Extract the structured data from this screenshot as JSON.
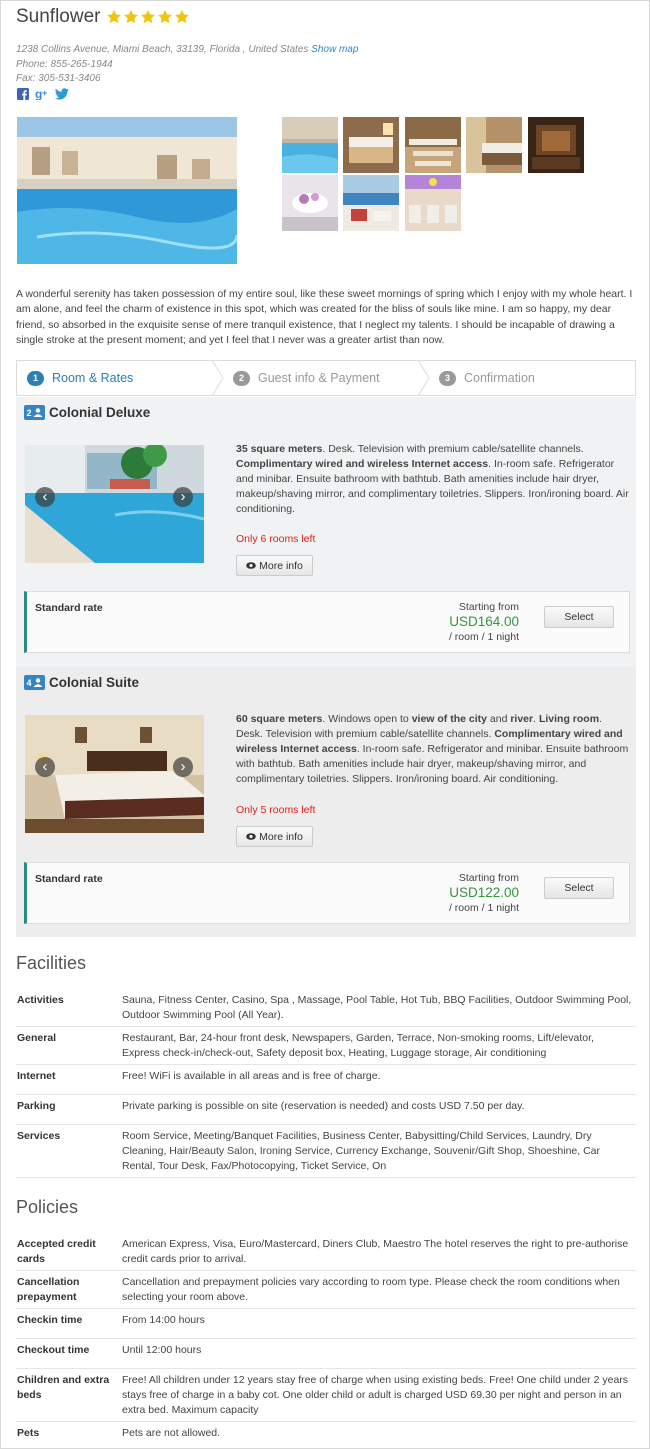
{
  "hotel": {
    "name": "Sunflower",
    "rating_stars": 5,
    "address": "1238 Collins Avenue, Miami Beach, 33139, Florida , United States",
    "show_map": "Show map",
    "phone": "Phone: 855-265-1944",
    "fax": "Fax: 305-531-3406",
    "description": "A wonderful serenity has taken possession of my entire soul, like these sweet mornings of spring which I enjoy with my whole heart. I am alone, and feel the charm of existence in this spot, which was created for the bliss of souls like mine. I am so happy, my dear friend, so absorbed in the exquisite sense of mere tranquil existence, that I neglect my talents. I should be incapable of drawing a single stroke at the present moment; and yet I feel that I never was a greater artist than now."
  },
  "social": [
    "facebook-icon",
    "google-plus-icon",
    "twitter-icon"
  ],
  "steps": [
    {
      "num": "1",
      "label": "Room & Rates",
      "active": true
    },
    {
      "num": "2",
      "label": "Guest info & Payment",
      "active": false
    },
    {
      "num": "3",
      "label": "Confirmation",
      "active": false
    }
  ],
  "rooms": [
    {
      "capacity": "2",
      "name": "Colonial Deluxe",
      "rooms_left": "Only 6 rooms left",
      "more_info": "More info",
      "rate_name": "Standard rate",
      "starting_from": "Starting from",
      "price": "USD164.00",
      "per": "/ room / 1 night",
      "select": "Select"
    },
    {
      "capacity": "4",
      "name": "Colonial Suite",
      "rooms_left": "Only 5 rooms left",
      "more_info": "More info",
      "rate_name": "Standard rate",
      "starting_from": "Starting from",
      "price": "USD122.00",
      "per": "/ room / 1 night",
      "select": "Select"
    }
  ],
  "room_text": {
    "r1_b1": "35 square meters",
    "r1_t1": ". Desk. Television with premium cable/satellite channels. ",
    "r1_b2": "Complimentary wired and wireless Internet access",
    "r1_t2": ". In-room safe. Refrigerator and minibar. Ensuite bathroom with bathtub. Bath amenities include hair dryer, makeup/shaving mirror, and complimentary toiletries. Slippers. Iron/ironing board. Air conditioning.",
    "r2_b1": "60 square meters",
    "r2_t1": ". Windows open to ",
    "r2_b2": "view of the city",
    "r2_t2": " and ",
    "r2_b3": "river",
    "r2_t3": ". ",
    "r2_b4": "Living room",
    "r2_t4": ". Desk. Television with premium cable/satellite channels. ",
    "r2_b5": "Complimentary wired and wireless Internet access",
    "r2_t5": ". In-room safe. Refrigerator and minibar. Ensuite bathroom with bathtub. Bath amenities include hair dryer, makeup/shaving mirror, and complimentary toiletries. Slippers. Iron/ironing board. Air conditioning."
  },
  "facilities": {
    "title": "Facilities",
    "rows": [
      {
        "k": "Activities",
        "v": "Sauna, Fitness Center, Casino, Spa , Massage, Pool Table, Hot Tub, BBQ Facilities, Outdoor Swimming Pool, Outdoor Swimming Pool (All Year)."
      },
      {
        "k": "General",
        "v": "Restaurant, Bar, 24-hour front desk, Newspapers, Garden, Terrace, Non-smoking rooms, Lift/elevator, Express check-in/check-out, Safety deposit box, Heating, Luggage storage, Air conditioning"
      },
      {
        "k": "Internet",
        "v": "Free! WiFi is available in all areas and is free of charge."
      },
      {
        "k": "Parking",
        "v": "Private parking is possible on site (reservation is needed) and costs USD 7.50 per day."
      },
      {
        "k": "Services",
        "v": "Room Service, Meeting/Banquet Facilities, Business Center, Babysitting/Child Services, Laundry, Dry Cleaning, Hair/Beauty Salon, Ironing Service, Currency Exchange, Souvenir/Gift Shop, Shoeshine, Car Rental, Tour Desk, Fax/Photocopying, Ticket Service, On"
      }
    ]
  },
  "policies": {
    "title": "Policies",
    "rows": [
      {
        "k": "Accepted credit cards",
        "v": "American Express, Visa, Euro/Mastercard, Diners Club, Maestro The hotel reserves the right to pre-authorise credit cards prior to arrival."
      },
      {
        "k": "Cancellation prepayment",
        "v": "Cancellation and prepayment policies vary according to room type. Please check the room conditions when selecting your room above."
      },
      {
        "k": "Checkin time",
        "v": "From 14:00 hours"
      },
      {
        "k": "Checkout time",
        "v": "Until 12:00 hours"
      },
      {
        "k": "Children and extra beds",
        "v": "Free! All children under 12 years stay free of charge when using existing beds. Free! One child under 2 years stays free of charge in a baby cot. One older child or adult is charged USD 69.30 per night and person in an extra bed. Maximum capacity"
      },
      {
        "k": "Pets",
        "v": "Pets are not allowed."
      }
    ]
  },
  "colors": {
    "accent": "#2a7fb5",
    "price_green": "#33963a",
    "alert_red": "#e0201b",
    "star": "#f4c30d",
    "rate_border": "#2b8a88"
  }
}
